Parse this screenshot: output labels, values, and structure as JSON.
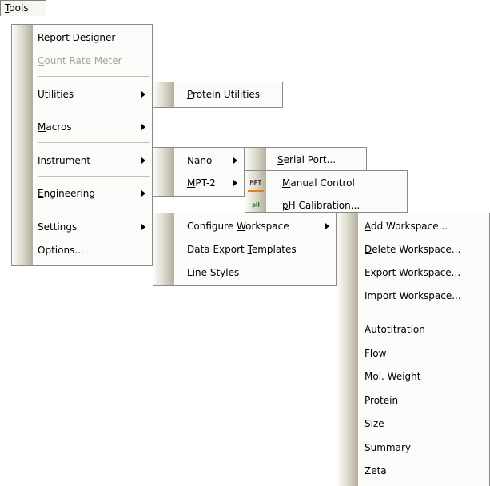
{
  "menubar": {
    "tools": {
      "pre": "",
      "key": "T",
      "post": "ools"
    }
  },
  "tools_menu": {
    "report_designer": {
      "pre": "",
      "key": "R",
      "post": "eport Designer"
    },
    "count_rate_meter": {
      "pre": "",
      "key": "C",
      "post": "ount Rate Meter"
    },
    "utilities": {
      "pre": "Utilities",
      "key": "",
      "post": ""
    },
    "macros": {
      "pre": "",
      "key": "M",
      "post": "acros"
    },
    "instrument": {
      "pre": "",
      "key": "I",
      "post": "nstrument"
    },
    "engineering": {
      "pre": "",
      "key": "E",
      "post": "ngineering"
    },
    "settings": {
      "pre": "Settings",
      "key": "",
      "post": ""
    },
    "options": {
      "pre": "Options...",
      "key": "",
      "post": ""
    }
  },
  "utilities_menu": {
    "protein_utilities": {
      "pre": "",
      "key": "P",
      "post": "rotein Utilities"
    }
  },
  "instrument_menu": {
    "nano": {
      "pre": "",
      "key": "N",
      "post": "ano"
    },
    "mpt2": {
      "pre": "",
      "key": "M",
      "post": "PT-2"
    }
  },
  "nano_menu": {
    "serial_port": {
      "pre": "",
      "key": "S",
      "post": "erial Port..."
    }
  },
  "mpt2_menu": {
    "manual_control": {
      "pre": "",
      "key": "M",
      "post": "anual Control"
    },
    "ph_calibration": {
      "pre": "",
      "key": "p",
      "post": "H Calibration..."
    },
    "icon_mpt": "MPT",
    "icon_ph": "pH"
  },
  "settings_menu": {
    "configure_workspace": {
      "pre": "Configure ",
      "key": "W",
      "post": "orkspace"
    },
    "data_export_templates": {
      "pre": "Data Export ",
      "key": "T",
      "post": "emplates"
    },
    "line_styles": {
      "pre": "Line St",
      "key": "y",
      "post": "les"
    }
  },
  "workspace_menu": {
    "add": {
      "pre": "",
      "key": "A",
      "post": "dd Workspace..."
    },
    "delete": {
      "pre": "",
      "key": "D",
      "post": "elete Workspace..."
    },
    "export": {
      "pre": "Export Workspace...",
      "key": "",
      "post": ""
    },
    "import": {
      "pre": "Import Workspace...",
      "key": "",
      "post": ""
    },
    "items": [
      "Autotitration",
      "Flow",
      "Mol. Weight",
      "Protein",
      "Size",
      "Summary",
      "Zeta"
    ]
  }
}
